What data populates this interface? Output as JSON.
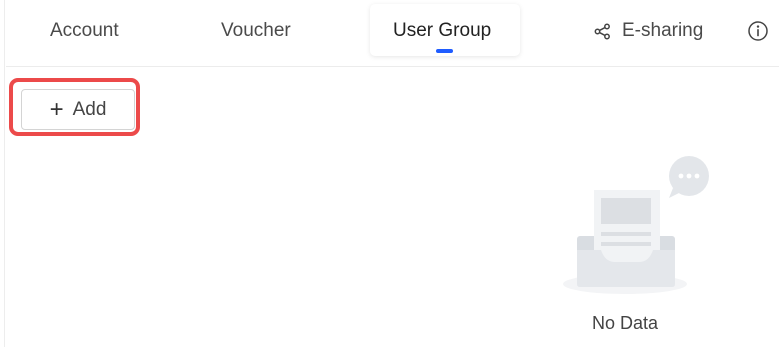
{
  "tabs": {
    "account": "Account",
    "voucher": "Voucher",
    "user_group": "User Group",
    "e_sharing": "E-sharing"
  },
  "toolbar": {
    "add_icon": "+",
    "add_label": "Add"
  },
  "empty_state": {
    "text": "No Data"
  },
  "colors": {
    "active_indicator": "#1f5cff",
    "highlight": "#ec4a4a"
  },
  "icons": {
    "e_sharing": "share-icon",
    "info": "info-icon",
    "empty": "empty-inbox-icon"
  }
}
